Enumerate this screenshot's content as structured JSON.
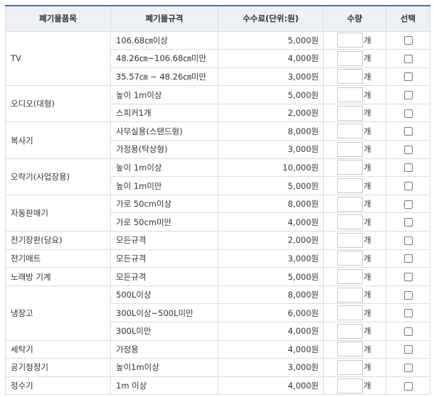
{
  "headers": {
    "item": "폐기물품목",
    "spec": "폐기물규격",
    "fee": "수수료(단위:원)",
    "qty": "수량",
    "select": "선택"
  },
  "unit_label": "개",
  "groups": [
    {
      "item": "TV",
      "rows": [
        {
          "spec": "106.68㎝이상",
          "fee": "5,000원"
        },
        {
          "spec": "48.26㎝~106.68㎝미만",
          "fee": "4,000원"
        },
        {
          "spec": "35.57㎝ ~ 48.26㎝미만",
          "fee": "3,000원"
        }
      ]
    },
    {
      "item": "오디오(대형)",
      "rows": [
        {
          "spec": "높이 1m이상",
          "fee": "5,000원"
        },
        {
          "spec": "스피커1개",
          "fee": "2,000원"
        }
      ]
    },
    {
      "item": "복사기",
      "rows": [
        {
          "spec": "사무실용(스탠드형)",
          "fee": "8,000원"
        },
        {
          "spec": "가정용(탁상형)",
          "fee": "3,000원"
        }
      ]
    },
    {
      "item": "오락기(사업장용)",
      "rows": [
        {
          "spec": "높이 1m이상",
          "fee": "10,000원"
        },
        {
          "spec": "높이 1m미만",
          "fee": "5,000원"
        }
      ]
    },
    {
      "item": "자동판매기",
      "rows": [
        {
          "spec": "가로 50cm이상",
          "fee": "8,000원"
        },
        {
          "spec": "가로 50cm미만",
          "fee": "4,000원"
        }
      ]
    },
    {
      "item": "전기장판(담요)",
      "rows": [
        {
          "spec": "모든규격",
          "fee": "2,000원"
        }
      ]
    },
    {
      "item": "전기매트",
      "rows": [
        {
          "spec": "모든규격",
          "fee": "3,000원"
        }
      ]
    },
    {
      "item": "노래방 기계",
      "rows": [
        {
          "spec": "모든규격",
          "fee": "5,000원"
        }
      ]
    },
    {
      "item": "냉장고",
      "rows": [
        {
          "spec": "500L이상",
          "fee": "8,000원"
        },
        {
          "spec": "300L이상~500L미만",
          "fee": "6,000원"
        },
        {
          "spec": "300L미만",
          "fee": "4,000원"
        }
      ]
    },
    {
      "item": "세탁기",
      "rows": [
        {
          "spec": "가정용",
          "fee": "4,000원"
        }
      ]
    },
    {
      "item": "공기청정기",
      "rows": [
        {
          "spec": "높이1m이상",
          "fee": "3,000원"
        }
      ]
    },
    {
      "item": "정수기",
      "rows": [
        {
          "spec": "1m 이상",
          "fee": "4,000원"
        }
      ]
    }
  ]
}
